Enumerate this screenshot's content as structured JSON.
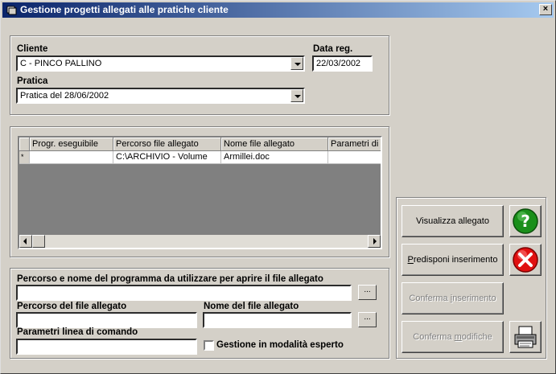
{
  "window": {
    "title": "Gestione progetti allegati alle pratiche cliente",
    "close_glyph": "×"
  },
  "top": {
    "cliente_label": "Cliente",
    "cliente_value": "C - PINCO PALLINO",
    "data_reg_label": "Data reg.",
    "data_reg_value": "22/03/2002",
    "pratica_label": "Pratica",
    "pratica_value": "Pratica del 28/06/2002"
  },
  "grid": {
    "columns": [
      "Progr. eseguibile",
      "Percorso file allegato",
      "Nome file allegato",
      "Parametri di a"
    ],
    "rows": [
      {
        "marker": "*",
        "progr": "",
        "percorso": "C:\\ARCHIVIO - Volume",
        "nome": "Armillei.doc",
        "parametri": ""
      }
    ]
  },
  "bottom": {
    "programma_label": "Percorso e nome del programma da utilizzare per aprire il file allegato",
    "programma_value": "",
    "percorso_label": "Percorso del file allegato",
    "percorso_value": "",
    "nome_label": "Nome del file allegato",
    "nome_value": "",
    "parametri_label": "Parametri linea di comando",
    "parametri_value": "",
    "esperto_label": "Gestione in modalità esperto",
    "browse_label": "..."
  },
  "buttons": {
    "visualizza": "Visualizza allegato",
    "predisponi": "Predisponi inserimento",
    "conferma_ins": "Conferma inserimento",
    "conferma_mod": "Conferma modifiche"
  },
  "icons": [
    "help-icon",
    "cancel-icon",
    "printer-icon"
  ],
  "colors": {
    "titlebar_start": "#0a246a",
    "titlebar_end": "#a6caf0",
    "help_green": "#1a8f1a",
    "cancel_red": "#e01010"
  }
}
